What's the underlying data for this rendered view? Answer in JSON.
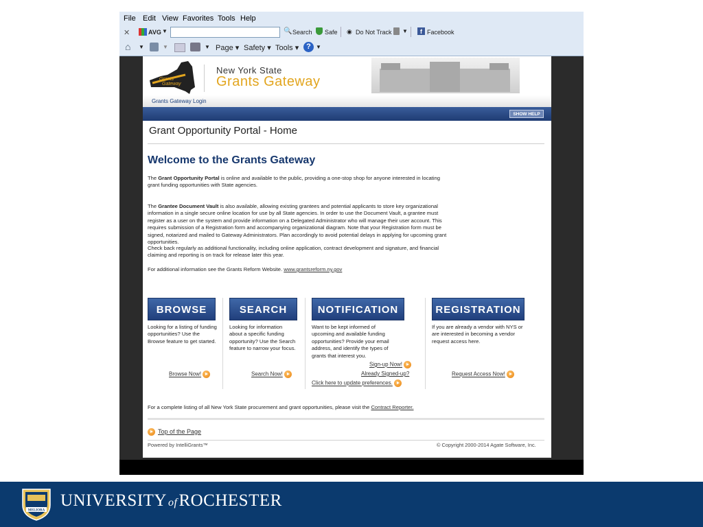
{
  "browser": {
    "menu": [
      "File",
      "Edit",
      "View",
      "Favorites",
      "Tools",
      "Help"
    ],
    "toolbar": {
      "avg": "AVG",
      "search": "Search",
      "safe": "Safe",
      "dnt": "Do Not Track",
      "facebook": "Facebook"
    },
    "command_bar": {
      "page": "Page",
      "safety": "Safety",
      "tools": "Tools"
    }
  },
  "site": {
    "state": "New York State",
    "name": "Grants Gateway",
    "login_tab": "Grants Gateway Login",
    "show_help": "SHOW HELP",
    "page_title": "Grant Opportunity Portal - Home",
    "welcome": "Welcome to the Grants Gateway",
    "para1_bold": "Grant Opportunity Portal",
    "para1_rest": " is online and available to the public, providing a one-stop shop for anyone interested in locating grant funding opportunities with State agencies.",
    "para1_prefix": "The ",
    "para2_prefix": "The ",
    "para2_bold": "Grantee Document Vault",
    "para2_rest": " is also available, allowing existing grantees and potential applicants to store key organizational information in a single secure online location for use by all State agencies. In order to use the Document Vault, a grantee must register as a user on the system and provide information on a Delegated Administrator who will manage their user account. This requires submission of a Registration form and accompanying organizational diagram. Note that your Registration form must be signed, notarized and mailed to Gateway Administrators. Plan accordingly to avoid potential delays in applying for upcoming grant opportunities.",
    "para3": "Check back regularly as additional functionality, including online application, contract development and signature, and financial claiming and reporting is on track for release later this year.",
    "para4_text": "For additional information see the Grants Reform Website. ",
    "para4_link": "www.grantsreform.ny.gov",
    "features": {
      "browse": {
        "title": "BROWSE",
        "desc": "Looking for a listing of funding opportunities? Use the Browse feature to get started.",
        "link": "Browse Now!"
      },
      "search": {
        "title": "SEARCH",
        "desc": "Looking for information about a specific funding opportunity? Use the Search feature to narrow your focus.",
        "link": "Search Now!"
      },
      "notification": {
        "title": "NOTIFICATION",
        "desc": "Want to be kept informed of upcoming and available funding opportunities? Provide your email address, and identify the types of grants that interest you.",
        "link1": "Sign-up Now!",
        "link2": "Already Signed-up?",
        "link3": "Click here to update preferences."
      },
      "registration": {
        "title": "REGISTRATION",
        "desc": "If you are already a vendor with NYS or are interested in becoming a vendor request access here.",
        "link": "Request Access Now!"
      }
    },
    "procurement_text": "For a complete listing of all New York State procurement and grant opportunities, please visit the ",
    "procurement_link": "Contract Reporter.",
    "top_link": "Top of the Page",
    "powered": "Powered by IntelliGrants™",
    "copyright": "© Copyright 2000-2014 Agate Software, Inc."
  },
  "slide_footer": {
    "university": "UNIVERSITY",
    "of": "of",
    "city": "ROCHESTER",
    "seal_text": "MELIORA"
  },
  "colors": {
    "footer_bg": "#0b3a6e",
    "button_blue": "#2c4f8f",
    "accent_orange": "#e8810c",
    "title_gold": "#e2a51e"
  }
}
